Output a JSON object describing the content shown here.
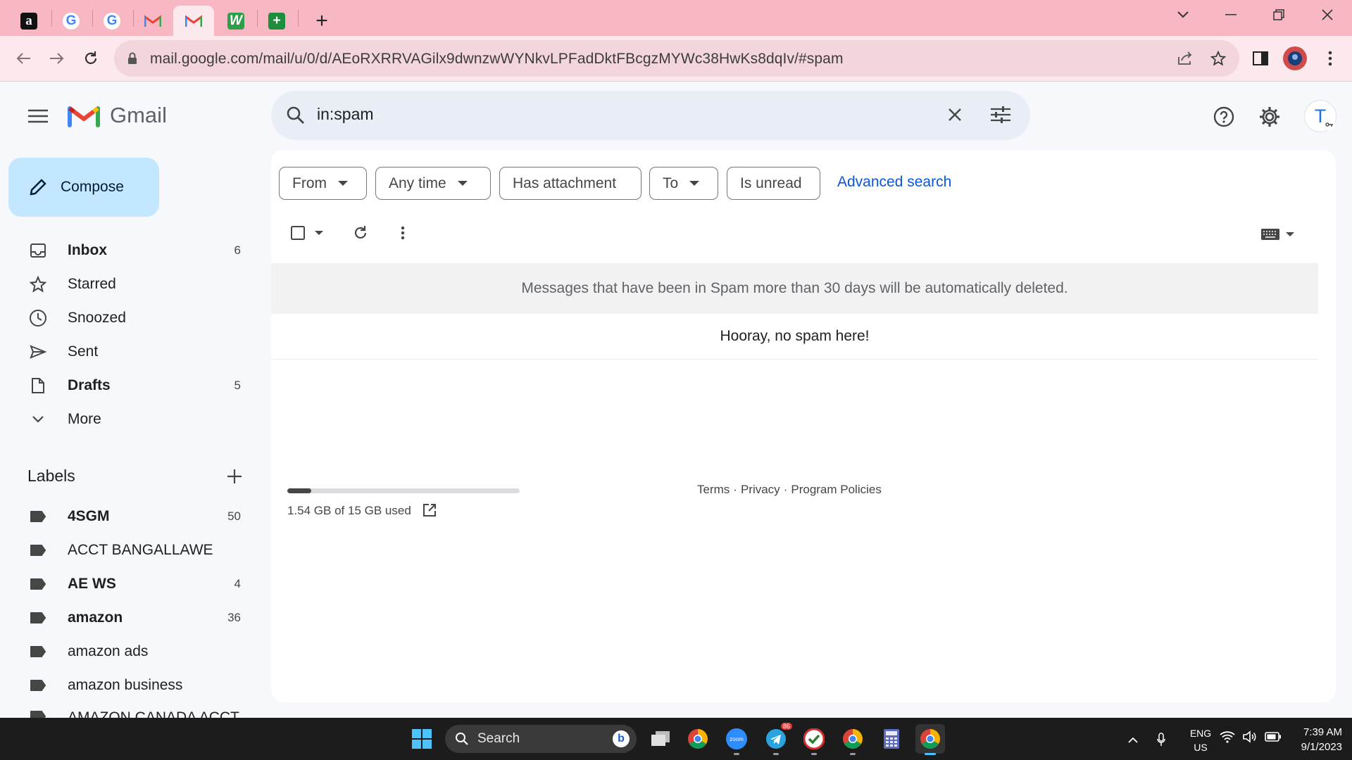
{
  "browser": {
    "tabs": [
      {
        "icon": "amazon-icon",
        "glyph": "a"
      },
      {
        "icon": "google-icon",
        "glyph": "G"
      },
      {
        "icon": "google-icon",
        "glyph": "G"
      },
      {
        "icon": "gmail-icon",
        "glyph": "M"
      },
      {
        "icon": "gmail-icon",
        "glyph": "M",
        "active": true
      },
      {
        "icon": "wave-icon",
        "glyph": "W"
      },
      {
        "icon": "sheets-icon",
        "glyph": "+"
      }
    ],
    "new_tab": "+",
    "url": "mail.google.com/mail/u/0/d/AEoRXRRVAGilx9dwnzwWYNkvLPFadDktFBcgzMYWc38HwKs8dqIv/#spam"
  },
  "gmail": {
    "logo_text": "Gmail",
    "search_value": "in:spam",
    "account_initial": "T",
    "compose_label": "Compose",
    "nav": [
      {
        "label": "Inbox",
        "count": "6",
        "bold": true,
        "icon": "inbox-icon"
      },
      {
        "label": "Starred",
        "count": "",
        "bold": false,
        "icon": "star-icon"
      },
      {
        "label": "Snoozed",
        "count": "",
        "bold": false,
        "icon": "clock-icon"
      },
      {
        "label": "Sent",
        "count": "",
        "bold": false,
        "icon": "send-icon"
      },
      {
        "label": "Drafts",
        "count": "5",
        "bold": true,
        "icon": "draft-icon"
      },
      {
        "label": "More",
        "count": "",
        "bold": false,
        "icon": "chevron-down-icon"
      }
    ],
    "labels_heading": "Labels",
    "labels": [
      {
        "label": "4SGM",
        "count": "50",
        "bold": true
      },
      {
        "label": "ACCT BANGALLAWE",
        "count": "",
        "bold": false
      },
      {
        "label": "AE WS",
        "count": "4",
        "bold": true
      },
      {
        "label": "amazon",
        "count": "36",
        "bold": true
      },
      {
        "label": "amazon ads",
        "count": "",
        "bold": false
      },
      {
        "label": "amazon business",
        "count": "",
        "bold": false
      },
      {
        "label": "AMAZON CANADA ACCT",
        "count": "",
        "bold": false
      }
    ],
    "filters": {
      "from": "From",
      "any_time": "Any time",
      "has_attachment": "Has attachment",
      "to": "To",
      "is_unread": "Is unread",
      "advanced": "Advanced search"
    },
    "notice": "Messages that have been in Spam more than 30 days will be automatically deleted.",
    "empty_message": "Hooray, no spam here!",
    "storage": {
      "text": "1.54 GB of 15 GB used",
      "fraction": 0.1027
    },
    "footer": {
      "terms": "Terms",
      "sep": "·",
      "privacy": "Privacy",
      "policies": "Program Policies"
    }
  },
  "taskbar": {
    "search_label": "Search",
    "lang_top": "ENG",
    "lang_bottom": "US",
    "time": "7:39 AM",
    "date": "9/1/2023",
    "telegram_badge": "86"
  },
  "colors": {
    "tabstrip": "#f7b8c4",
    "toolbar": "#fbe9ed",
    "compose": "#c2e7ff",
    "link": "#0b57d0"
  }
}
